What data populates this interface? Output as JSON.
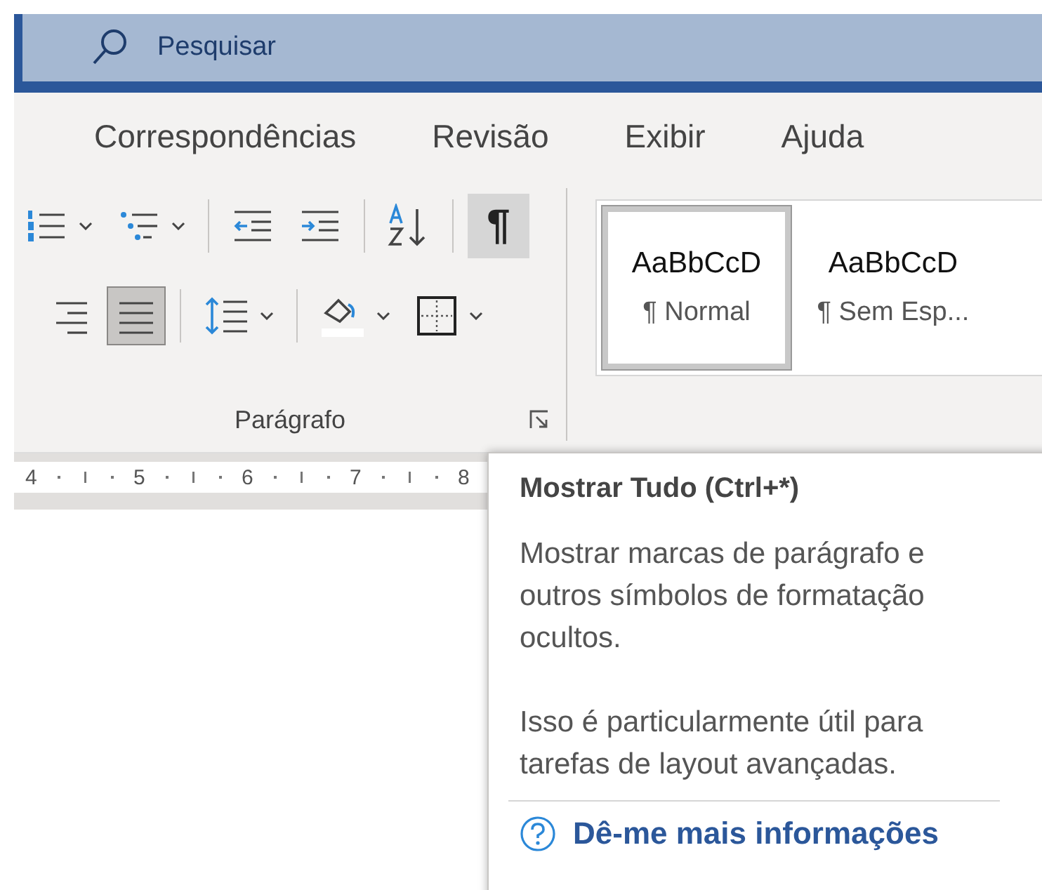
{
  "search": {
    "placeholder": "Pesquisar"
  },
  "tabs": [
    {
      "label": "Correspondências",
      "selected": false
    },
    {
      "label": "Revisão",
      "selected": false
    },
    {
      "label": "Exibir",
      "selected": false
    },
    {
      "label": "Ajuda",
      "selected": false
    }
  ],
  "paragraph_group": {
    "label": "Parágrafo",
    "rows": [
      [
        {
          "kind": "numbering",
          "selected": false,
          "dropdown": true
        },
        {
          "kind": "multilevel",
          "selected": false,
          "dropdown": true
        },
        {
          "kind": "separator"
        },
        {
          "kind": "outdent",
          "selected": false,
          "dropdown": false
        },
        {
          "kind": "indent",
          "selected": false,
          "dropdown": false
        },
        {
          "kind": "separator"
        },
        {
          "kind": "sort",
          "selected": false,
          "dropdown": false
        },
        {
          "kind": "separator"
        },
        {
          "kind": "marks",
          "text": "¶",
          "selected": true,
          "dropdown": false
        }
      ],
      [
        {
          "kind": "align_right",
          "selected": false,
          "dropdown": false
        },
        {
          "kind": "justify",
          "selected": true,
          "dropdown": false
        },
        {
          "kind": "separator"
        },
        {
          "kind": "line_spacing",
          "selected": false,
          "dropdown": true
        },
        {
          "kind": "separator"
        },
        {
          "kind": "shading",
          "selected": false,
          "dropdown": true
        },
        {
          "kind": "borders",
          "selected": false,
          "dropdown": true
        }
      ]
    ]
  },
  "styles": [
    {
      "preview": "AaBbCcD",
      "label": "¶ Normal",
      "selected": true
    },
    {
      "preview": "AaBbCcD",
      "label": "¶ Sem Esp...",
      "selected": false
    }
  ],
  "ruler": [
    "4",
    "5",
    "6",
    "7",
    "8"
  ],
  "tooltip": {
    "title": "Mostrar Tudo (Ctrl+*)",
    "paragraphs": [
      "Mostrar marcas de parágrafo e outros símbolos de formatação ocultos.",
      "Isso é particularmente útil para tarefas de layout avançadas."
    ],
    "link": "Dê-me mais informações"
  }
}
